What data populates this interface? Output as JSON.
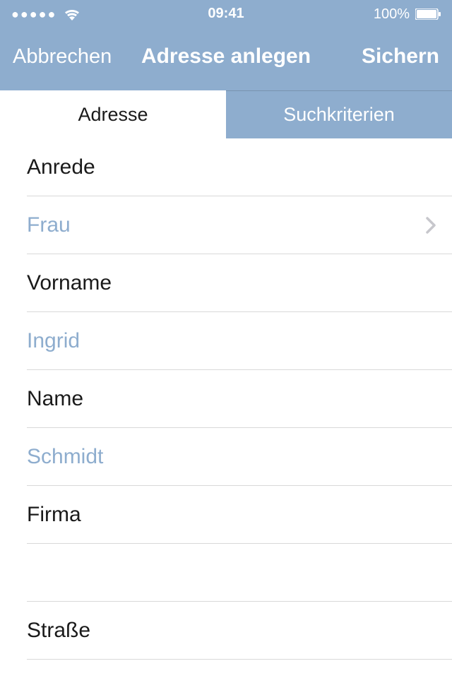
{
  "status": {
    "time": "09:41",
    "battery": "100%"
  },
  "nav": {
    "cancel": "Abbrechen",
    "title": "Adresse anlegen",
    "save": "Sichern"
  },
  "tabs": {
    "address": "Adresse",
    "criteria": "Suchkriterien"
  },
  "form": {
    "salutation_label": "Anrede",
    "salutation_value": "Frau",
    "firstname_label": "Vorname",
    "firstname_value": "Ingrid",
    "lastname_label": "Name",
    "lastname_value": "Schmidt",
    "company_label": "Firma",
    "company_value": "",
    "street_label": "Straße"
  }
}
